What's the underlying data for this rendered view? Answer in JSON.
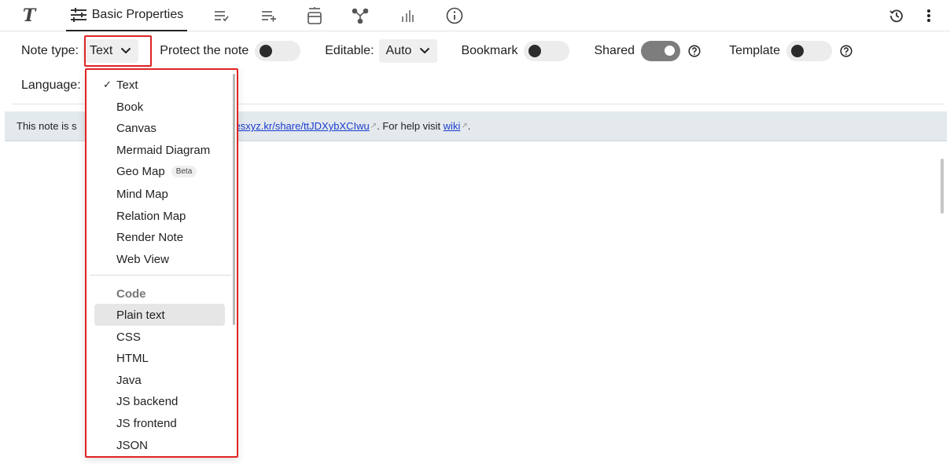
{
  "ribbon": {
    "text_tab_glyph": "T",
    "active_tab_label": "Basic Properties",
    "icons": [
      "text-tab-icon",
      "basic-properties-icon",
      "owned-attributes-icon",
      "inherited-attributes-icon",
      "promoted-attributes-icon",
      "note-map-icon",
      "similar-notes-icon",
      "note-info-icon",
      "note-revisions-icon",
      "more-menu-icon"
    ]
  },
  "props": {
    "note_type_label": "Note type:",
    "note_type_value": "Text",
    "protect_label": "Protect the note",
    "protect_on": false,
    "editable_label": "Editable:",
    "editable_value": "Auto",
    "bookmark_label": "Bookmark",
    "bookmark_on": false,
    "shared_label": "Shared",
    "shared_on": true,
    "template_label": "Template",
    "template_on": false,
    "language_label": "Language:"
  },
  "banner": {
    "prefix": "This note is s",
    "link_text": "m.yesxyz.kr/share/ttJDXybXCIwu",
    "link_ext": "↗",
    "middle": ". For help visit ",
    "wiki_text": "wiki",
    "wiki_ext": "↗",
    "suffix": "."
  },
  "dropdown": {
    "check_glyph": "✓",
    "items": [
      {
        "label": "Text",
        "checked": true
      },
      {
        "label": "Book"
      },
      {
        "label": "Canvas"
      },
      {
        "label": "Mermaid Diagram"
      },
      {
        "label": "Geo Map",
        "badge": "Beta"
      },
      {
        "label": "Mind Map"
      },
      {
        "label": "Relation Map"
      },
      {
        "label": "Render Note"
      },
      {
        "label": "Web View"
      }
    ],
    "code_header": "Code",
    "code_items": [
      {
        "label": "Plain text",
        "highlighted": true
      },
      {
        "label": "CSS"
      },
      {
        "label": "HTML"
      },
      {
        "label": "Java"
      },
      {
        "label": "JS backend"
      },
      {
        "label": "JS frontend"
      },
      {
        "label": "JSON"
      }
    ]
  },
  "colors": {
    "highlight_border": "#e02424",
    "banner_bg": "#e3e9ed",
    "link": "#1a3ccf",
    "toggle_on": "#7d7d7d"
  }
}
